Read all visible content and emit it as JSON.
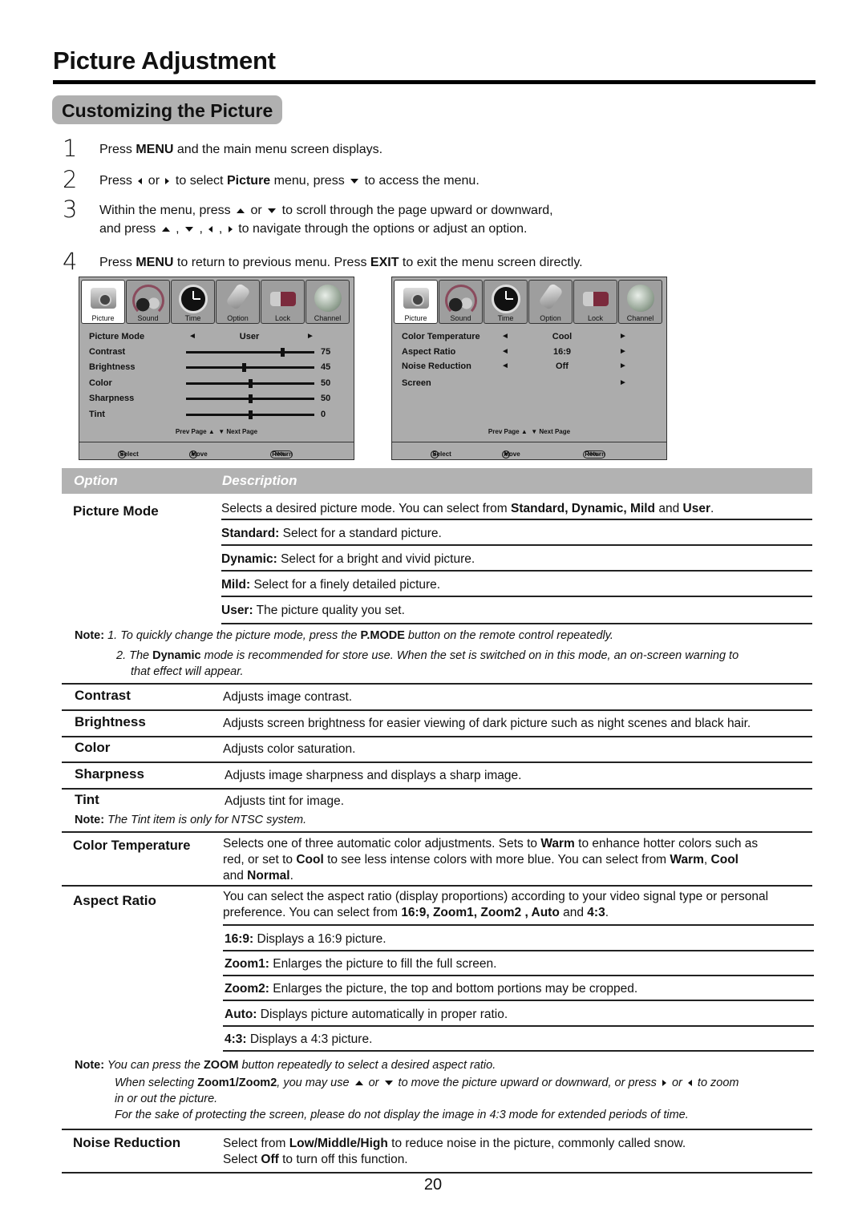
{
  "page": {
    "title": "Picture Adjustment",
    "section": "Customizing the Picture",
    "page_number": "20"
  },
  "steps": [
    {
      "num": "1",
      "parts": [
        "Press ",
        "MENU",
        " and the main menu screen displays."
      ]
    },
    {
      "num": "2",
      "parts": [
        "Press ",
        " or ",
        " to select ",
        "Picture",
        " menu,  press ",
        " to access the menu."
      ]
    },
    {
      "num": "3",
      "line1": [
        "Within the menu, press ",
        " or ",
        " to scroll through the page upward or downward,"
      ],
      "line2": [
        "and press ",
        " , ",
        " , ",
        " , ",
        " to navigate through the options or adjust an option."
      ]
    },
    {
      "num": "4",
      "parts": [
        "Press ",
        "MENU",
        " to return to previous menu. Press ",
        "EXIT",
        " to exit the menu screen directly."
      ]
    }
  ],
  "osd_tabs": [
    {
      "label": "Picture",
      "icon": "camera-icon",
      "active": true
    },
    {
      "label": "Sound",
      "icon": "headphones-icon",
      "active": false
    },
    {
      "label": "Time",
      "icon": "clock-icon",
      "active": false
    },
    {
      "label": "Option",
      "icon": "plug-icon",
      "active": false
    },
    {
      "label": "Lock",
      "icon": "lock-icon",
      "active": false
    },
    {
      "label": "Channel",
      "icon": "globe-icon",
      "active": false
    }
  ],
  "osd_menu_1": {
    "picture_mode": {
      "label": "Picture Mode",
      "value": "User"
    },
    "sliders": [
      {
        "label": "Contrast",
        "value": "75",
        "fraction": 0.75
      },
      {
        "label": "Brightness",
        "value": "45",
        "fraction": 0.45
      },
      {
        "label": "Color",
        "value": "50",
        "fraction": 0.5
      },
      {
        "label": "Sharpness",
        "value": "50",
        "fraction": 0.5
      },
      {
        "label": "Tint",
        "value": "0",
        "fraction": 0.5
      }
    ]
  },
  "osd_menu_2": {
    "items": [
      {
        "label": "Color Temperature",
        "value": "Cool"
      },
      {
        "label": "Aspect Ratio",
        "value": "16:9"
      },
      {
        "label": "Noise Reduction",
        "value": "Off"
      },
      {
        "label": "Screen",
        "value": ""
      }
    ]
  },
  "osd_common": {
    "pager_prev": "Prev  Page",
    "pager_next": "Next  Page",
    "footer_select": "Select",
    "footer_move": "Move",
    "footer_menu_key": "Menu",
    "footer_return": "Return"
  },
  "table": {
    "header_option": "Option",
    "header_description": "Description",
    "picture_mode": {
      "option": "Picture Mode",
      "intro": [
        "Selects a desired picture mode. You can select from ",
        "Standard, Dynamic, Mild",
        " and ",
        "User",
        "."
      ],
      "items": [
        {
          "term": "Standard:",
          "text": " Select for a standard picture."
        },
        {
          "term": "Dynamic:",
          "text": " Select for a bright and vivid picture."
        },
        {
          "term": "Mild:",
          "text": " Select for a finely detailed picture."
        },
        {
          "term": "User:",
          "text": " The picture quality you set."
        }
      ],
      "note_label": "Note:",
      "note1": [
        "1. To quickly change the picture mode, press the ",
        "P.MODE",
        " button on the remote control repeatedly."
      ],
      "note2": [
        "2. The ",
        "Dynamic",
        " mode is recommended for store use. When the set is switched on in this mode, an on-screen warning to"
      ],
      "note2b": "that effect will appear."
    },
    "simple_rows": [
      {
        "option": "Contrast",
        "text": "Adjusts image contrast."
      },
      {
        "option": "Brightness",
        "text": "Adjusts screen brightness for easier viewing of dark picture such as night scenes and black hair."
      },
      {
        "option": "Color",
        "text": "Adjusts color saturation."
      },
      {
        "option": "Sharpness",
        "text": "Adjusts image sharpness and displays a sharp image."
      },
      {
        "option": "Tint",
        "text": "Adjusts tint for image."
      }
    ],
    "tint_note": [
      "Note:",
      " The Tint item is only for NTSC system."
    ],
    "color_temp": {
      "option": "Color Temperature",
      "line1": [
        "Selects one of three automatic color adjustments.  Sets to ",
        "Warm",
        " to enhance hotter colors such as"
      ],
      "line2": [
        "red,  or set to ",
        "Cool",
        " to see less intense colors with more blue.  You can select from ",
        "Warm",
        ", ",
        "Cool"
      ],
      "line3": [
        "and ",
        "Normal",
        "."
      ]
    },
    "aspect_ratio": {
      "option": "Aspect Ratio",
      "line1": "You can select the aspect ratio (display proportions) according to your video signal type or personal",
      "line2": [
        "preference. You can select from ",
        "16:9,  Zoom1, Zoom2 , Auto",
        " and ",
        "4:3",
        "."
      ],
      "items": [
        {
          "term": "16:9:",
          "text": " Displays a 16:9 picture."
        },
        {
          "term": "Zoom1:",
          "text": " Enlarges the picture to fill the full screen."
        },
        {
          "term": "Zoom2:",
          "text": " Enlarges the picture, the top and bottom portions may be cropped."
        },
        {
          "term": "Auto:",
          "text": " Displays picture automatically in proper ratio."
        },
        {
          "term": "4:3:",
          "text": " Displays a 4:3 picture."
        }
      ],
      "note_label": "Note:",
      "note1": [
        " You can press the ",
        "ZOOM",
        " button repeatedly to select a desired aspect ratio."
      ],
      "note2": [
        "When selecting ",
        "Zoom1/Zoom2",
        ", you may use ",
        " or ",
        " to move the picture upward or downward, or press ",
        " or ",
        " to zoom"
      ],
      "note2b": "in or out the picture.",
      "note3": "For the sake of protecting the screen, please do not display the image in 4:3 mode for extended periods of time."
    },
    "noise_reduction": {
      "option": "Noise Reduction",
      "line1": [
        "Select from ",
        "Low/Middle/High",
        " to reduce noise in the picture, commonly called snow."
      ],
      "line2": [
        "Select ",
        "Off",
        " to turn off this function."
      ]
    }
  }
}
